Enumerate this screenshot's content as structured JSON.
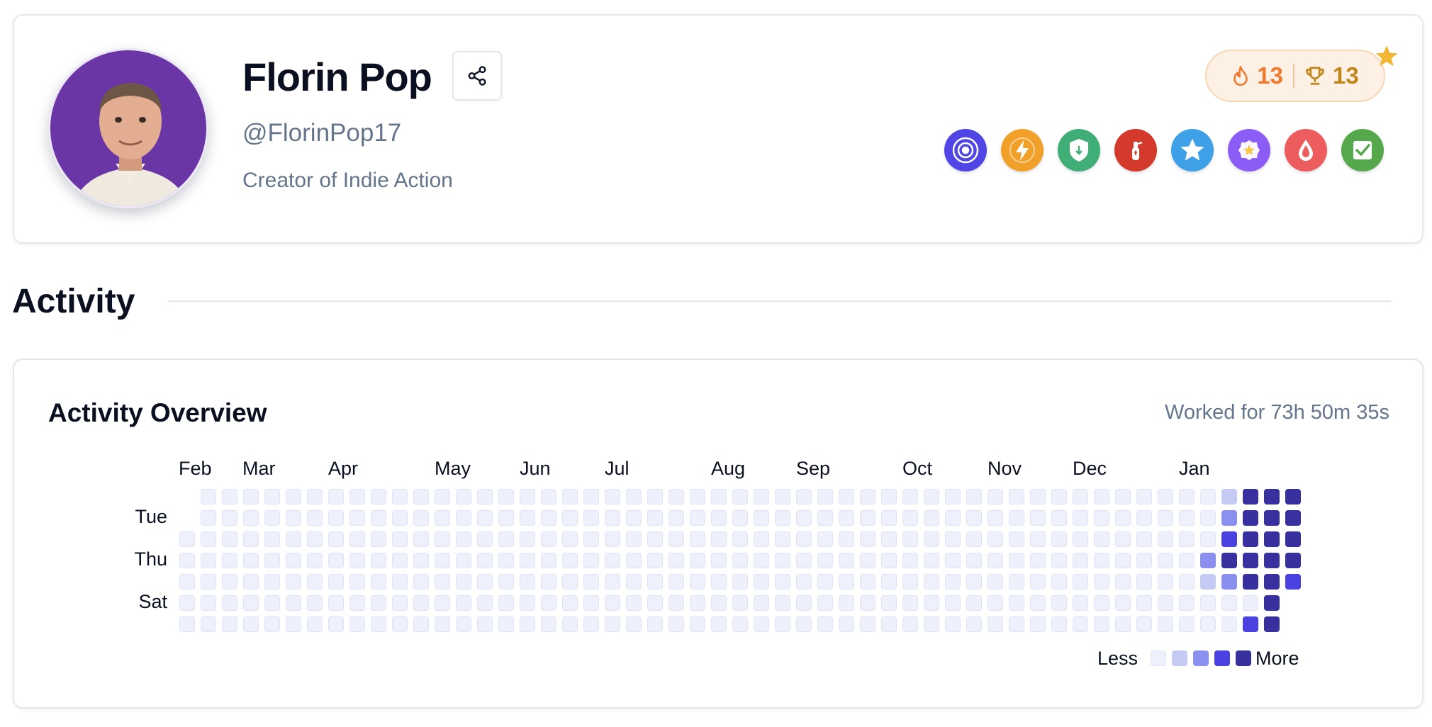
{
  "profile": {
    "name": "Florin Pop",
    "handle": "@FlorinPop17",
    "bio": "Creator of Indie Action",
    "streak": "13",
    "trophies": "13"
  },
  "badges": [
    {
      "icon": "target-icon",
      "color": "#4f46e5"
    },
    {
      "icon": "lightning-icon",
      "color": "#f1a029"
    },
    {
      "icon": "shield-icon",
      "color": "#3fae77"
    },
    {
      "icon": "fire-extinguisher-icon",
      "color": "#d33a2c"
    },
    {
      "icon": "star-icon",
      "color": "#3ea0e6"
    },
    {
      "icon": "star-badge-icon",
      "color": "#8b5cf6"
    },
    {
      "icon": "drop-icon",
      "color": "#ee5d5d"
    },
    {
      "icon": "checkbox-icon",
      "color": "#55a84c"
    }
  ],
  "activity": {
    "section_title": "Activity",
    "overview_title": "Activity Overview",
    "worked": "Worked for 73h 50m 35s",
    "months": [
      "Feb",
      "Mar",
      "Apr",
      "May",
      "Jun",
      "Jul",
      "Aug",
      "Sep",
      "Oct",
      "Nov",
      "Dec",
      "Jan"
    ],
    "weekdays": [
      "Tue",
      "Thu",
      "Sat"
    ],
    "legend_less": "Less",
    "legend_more": "More",
    "level_colors": [
      "#eef0fc",
      "#c5cbf5",
      "#8b8ff0",
      "#4b40e0",
      "#37309e"
    ],
    "recent_levels": [
      [
        0,
        0,
        0,
        0,
        0,
        1,
        4,
        4,
        4
      ],
      [
        0,
        0,
        0,
        0,
        0,
        2,
        4,
        4,
        4
      ],
      [
        0,
        0,
        0,
        0,
        0,
        3,
        4,
        4,
        4
      ],
      [
        0,
        0,
        0,
        0,
        2,
        4,
        4,
        4,
        4
      ],
      [
        0,
        0,
        0,
        0,
        1,
        2,
        4,
        4,
        3
      ],
      [
        0,
        0,
        0,
        0,
        0,
        0,
        0,
        4,
        null
      ],
      [
        0,
        0,
        0,
        0,
        0,
        0,
        3,
        4,
        null
      ]
    ]
  }
}
